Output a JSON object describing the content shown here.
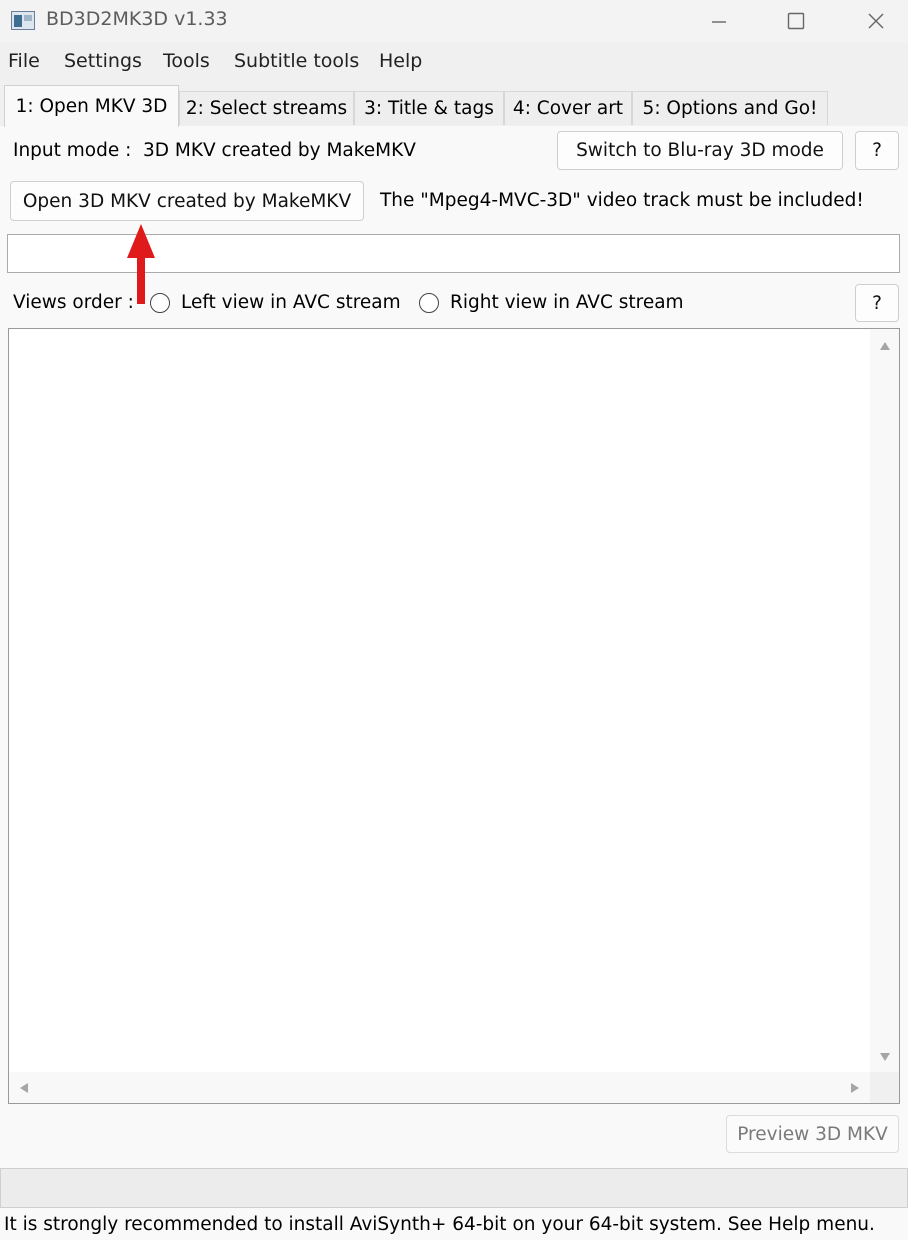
{
  "window": {
    "title": "BD3D2MK3D v1.33",
    "icon": "app-window-icon",
    "minimize_icon": "minimize-icon",
    "maximize_icon": "maximize-icon",
    "close_icon": "close-icon"
  },
  "menu": [
    "File",
    "Settings",
    "Tools",
    "Subtitle tools",
    "Help"
  ],
  "tabs": [
    "1: Open MKV 3D",
    "2: Select streams",
    "3: Title & tags",
    "4: Cover art",
    "5: Options and Go!"
  ],
  "input_mode": {
    "label": "Input mode :",
    "value": "3D MKV created by MakeMKV",
    "switch_button": "Switch to Blu-ray 3D mode",
    "help_button": "?"
  },
  "open": {
    "button": "Open 3D MKV created by MakeMKV",
    "note": "The \"Mpeg4-MVC-3D\" video track must be included!",
    "file_path": ""
  },
  "annotation": {
    "arrow_color": "#e0191b",
    "icon": "red-arrow-up-icon"
  },
  "views_order": {
    "label": "Views order :",
    "options": [
      "Left view in AVC stream",
      "Right view in AVC stream"
    ],
    "help_button": "?"
  },
  "preview_button": "Preview 3D MKV",
  "status_text": "",
  "footer_note": "It is strongly recommended to install AviSynth+ 64-bit on your 64-bit system.  See Help menu."
}
